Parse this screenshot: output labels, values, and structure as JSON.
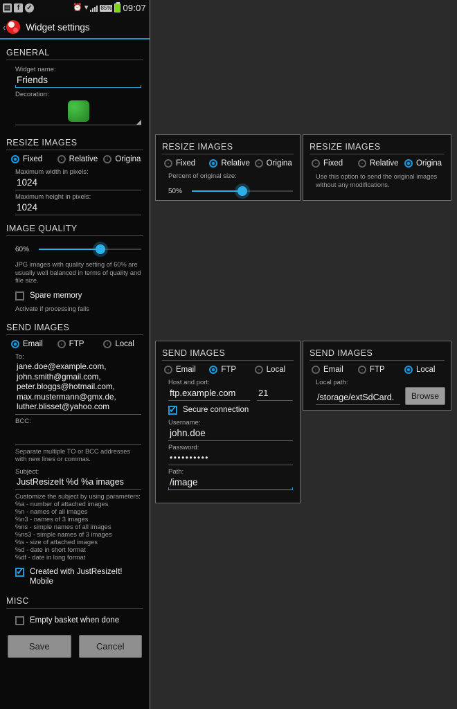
{
  "statusbar": {
    "icons": [
      "gallery-icon",
      "facebook-icon",
      "check-circle-icon",
      "alarm-icon",
      "wifi-icon",
      "signal-icon"
    ],
    "battery_percent": "85%",
    "clock": "09:07"
  },
  "actionbar": {
    "back": "‹",
    "title": "Widget settings"
  },
  "sections": {
    "general": {
      "title": "GENERAL",
      "widget_name_label": "Widget name:",
      "widget_name_value": "Friends",
      "decoration_label": "Decoration:"
    },
    "resize": {
      "title": "RESIZE IMAGES",
      "options": [
        "Fixed",
        "Relative",
        "Origina"
      ],
      "selected": "Fixed",
      "max_width_label": "Maximum width in pixels:",
      "max_width_value": "1024",
      "max_height_label": "Maximum height in pixels:",
      "max_height_value": "1024"
    },
    "quality": {
      "title": "IMAGE QUALITY",
      "value": "60%",
      "percent": 60,
      "hint": "JPG images with quality setting of 60% are usually well balanced in terms of quality and file size.",
      "spare_memory_label": "Spare memory",
      "spare_memory_checked": false,
      "spare_memory_hint": "Activate if processing fails"
    },
    "send": {
      "title": "SEND IMAGES",
      "options": [
        "Email",
        "FTP",
        "Local"
      ],
      "selected": "Email",
      "to_label": "To:",
      "to_value": "jane.doe@example.com, john.smith@gmail.com, peter.bloggs@hotmail.com, max.mustermann@gmx.de, luther.blisset@yahoo.com",
      "bcc_label": "BCC:",
      "bcc_value": "",
      "addresses_hint": "Separate multiple TO or BCC addresses with new lines or commas.",
      "subject_label": "Subject:",
      "subject_value": "JustResizeIt %d %a images",
      "subject_hint": "Customize the subject by using parameters:\n%a - number of attached images\n%n - names of all images\n%n3 - names of 3 images\n%ns - simple names of all images\n%ns3 - simple names of 3 images\n%s - size of attached images\n%d - date in short format\n%df - date in long format",
      "signature_label": "Created with JustResizeIt! Mobile",
      "signature_checked": true
    },
    "misc": {
      "title": "MISC",
      "empty_basket_label": "Empty basket when done",
      "empty_basket_checked": false
    }
  },
  "buttons": {
    "save": "Save",
    "cancel": "Cancel"
  },
  "panels": {
    "resize_relative": {
      "title": "RESIZE IMAGES",
      "options": [
        "Fixed",
        "Relative",
        "Origina"
      ],
      "selected": "Relative",
      "percent_label": "Percent of original size:",
      "percent_value": "50%",
      "percent": 50
    },
    "resize_original": {
      "title": "RESIZE IMAGES",
      "options": [
        "Fixed",
        "Relative",
        "Origina"
      ],
      "selected": "Origina",
      "hint": "Use this option to send the original images without any modifications."
    },
    "send_ftp": {
      "title": "SEND IMAGES",
      "options": [
        "Email",
        "FTP",
        "Local"
      ],
      "selected": "FTP",
      "host_label": "Host and port:",
      "host_value": "ftp.example.com",
      "port_value": "21",
      "secure_label": "Secure connection",
      "secure_checked": true,
      "username_label": "Username:",
      "username_value": "john.doe",
      "password_label": "Password:",
      "password_value": "••••••••••",
      "path_label": "Path:",
      "path_value": "/image"
    },
    "send_local": {
      "title": "SEND IMAGES",
      "options": [
        "Email",
        "FTP",
        "Local"
      ],
      "selected": "Local",
      "local_path_label": "Local path:",
      "local_path_value": "/storage/extSdCard.",
      "browse_label": "Browse"
    }
  },
  "colors": {
    "accent": "#2aa5dd",
    "background": "#0a0a0a",
    "decoration": "#2fa32f"
  }
}
